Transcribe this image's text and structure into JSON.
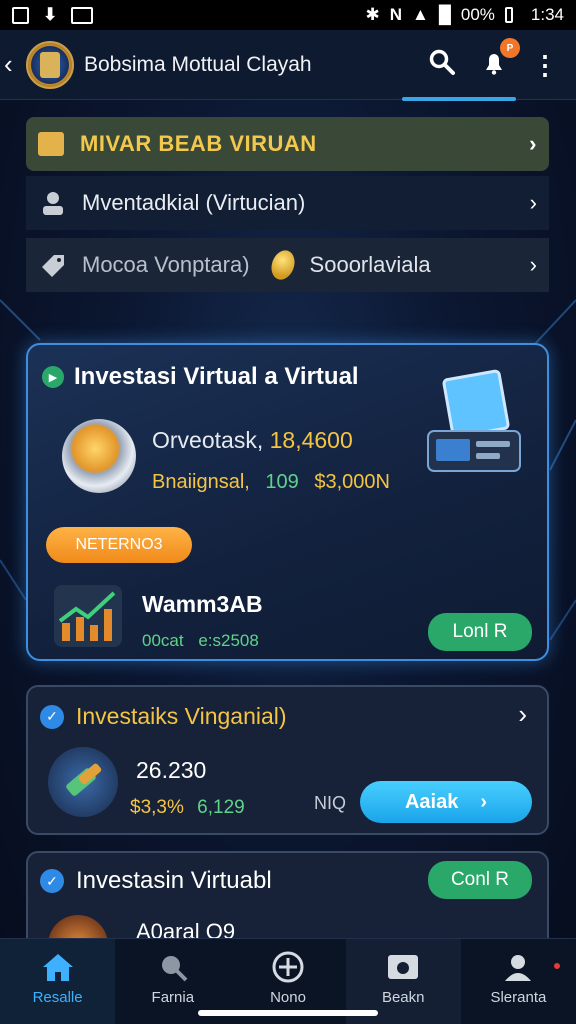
{
  "status_bar": {
    "battery": "00%",
    "time": "1:34"
  },
  "app_bar": {
    "title": "Bobsima Mottual Clayah"
  },
  "notification_badge": "P",
  "menu": [
    {
      "label": "MIVAR BEAB VIRUAN"
    },
    {
      "label": "Mventadkial (Virtucian)"
    },
    {
      "label": "Mocoa Vonptara)",
      "extra": "Sooorlaviala"
    }
  ],
  "featured_card": {
    "title": "Investasi  Virtual a Virtual",
    "line1_label": "Orveotask,",
    "line1_value": "18,4600",
    "line2_label": "Bnaiignsal,",
    "line2_value1": "109",
    "line2_value2": "$3,000N",
    "tag": "NETERNO3",
    "name": "Wamm3AB",
    "footer1": "00cat",
    "footer2": "e:s2508",
    "button": "Lonl R"
  },
  "card2": {
    "title": "Investaiks Vinganial)",
    "amount": "26.230",
    "sub1": "$3,3%",
    "sub2": "6,129",
    "sub3": "NIQ",
    "button": "Aaiak"
  },
  "card3": {
    "title": "Investasin Virtuabl",
    "button": "Conl R",
    "partial": "A0aral Q9"
  },
  "nav": [
    {
      "label": "Resalle"
    },
    {
      "label": "Farnia"
    },
    {
      "label": "Nono"
    },
    {
      "label": "Beakn"
    },
    {
      "label": "Sleranta"
    }
  ],
  "colors": {
    "accent": "#3fb0ff",
    "gold": "#f2c94c",
    "green": "#2aa86a",
    "orange": "#f5a623"
  }
}
